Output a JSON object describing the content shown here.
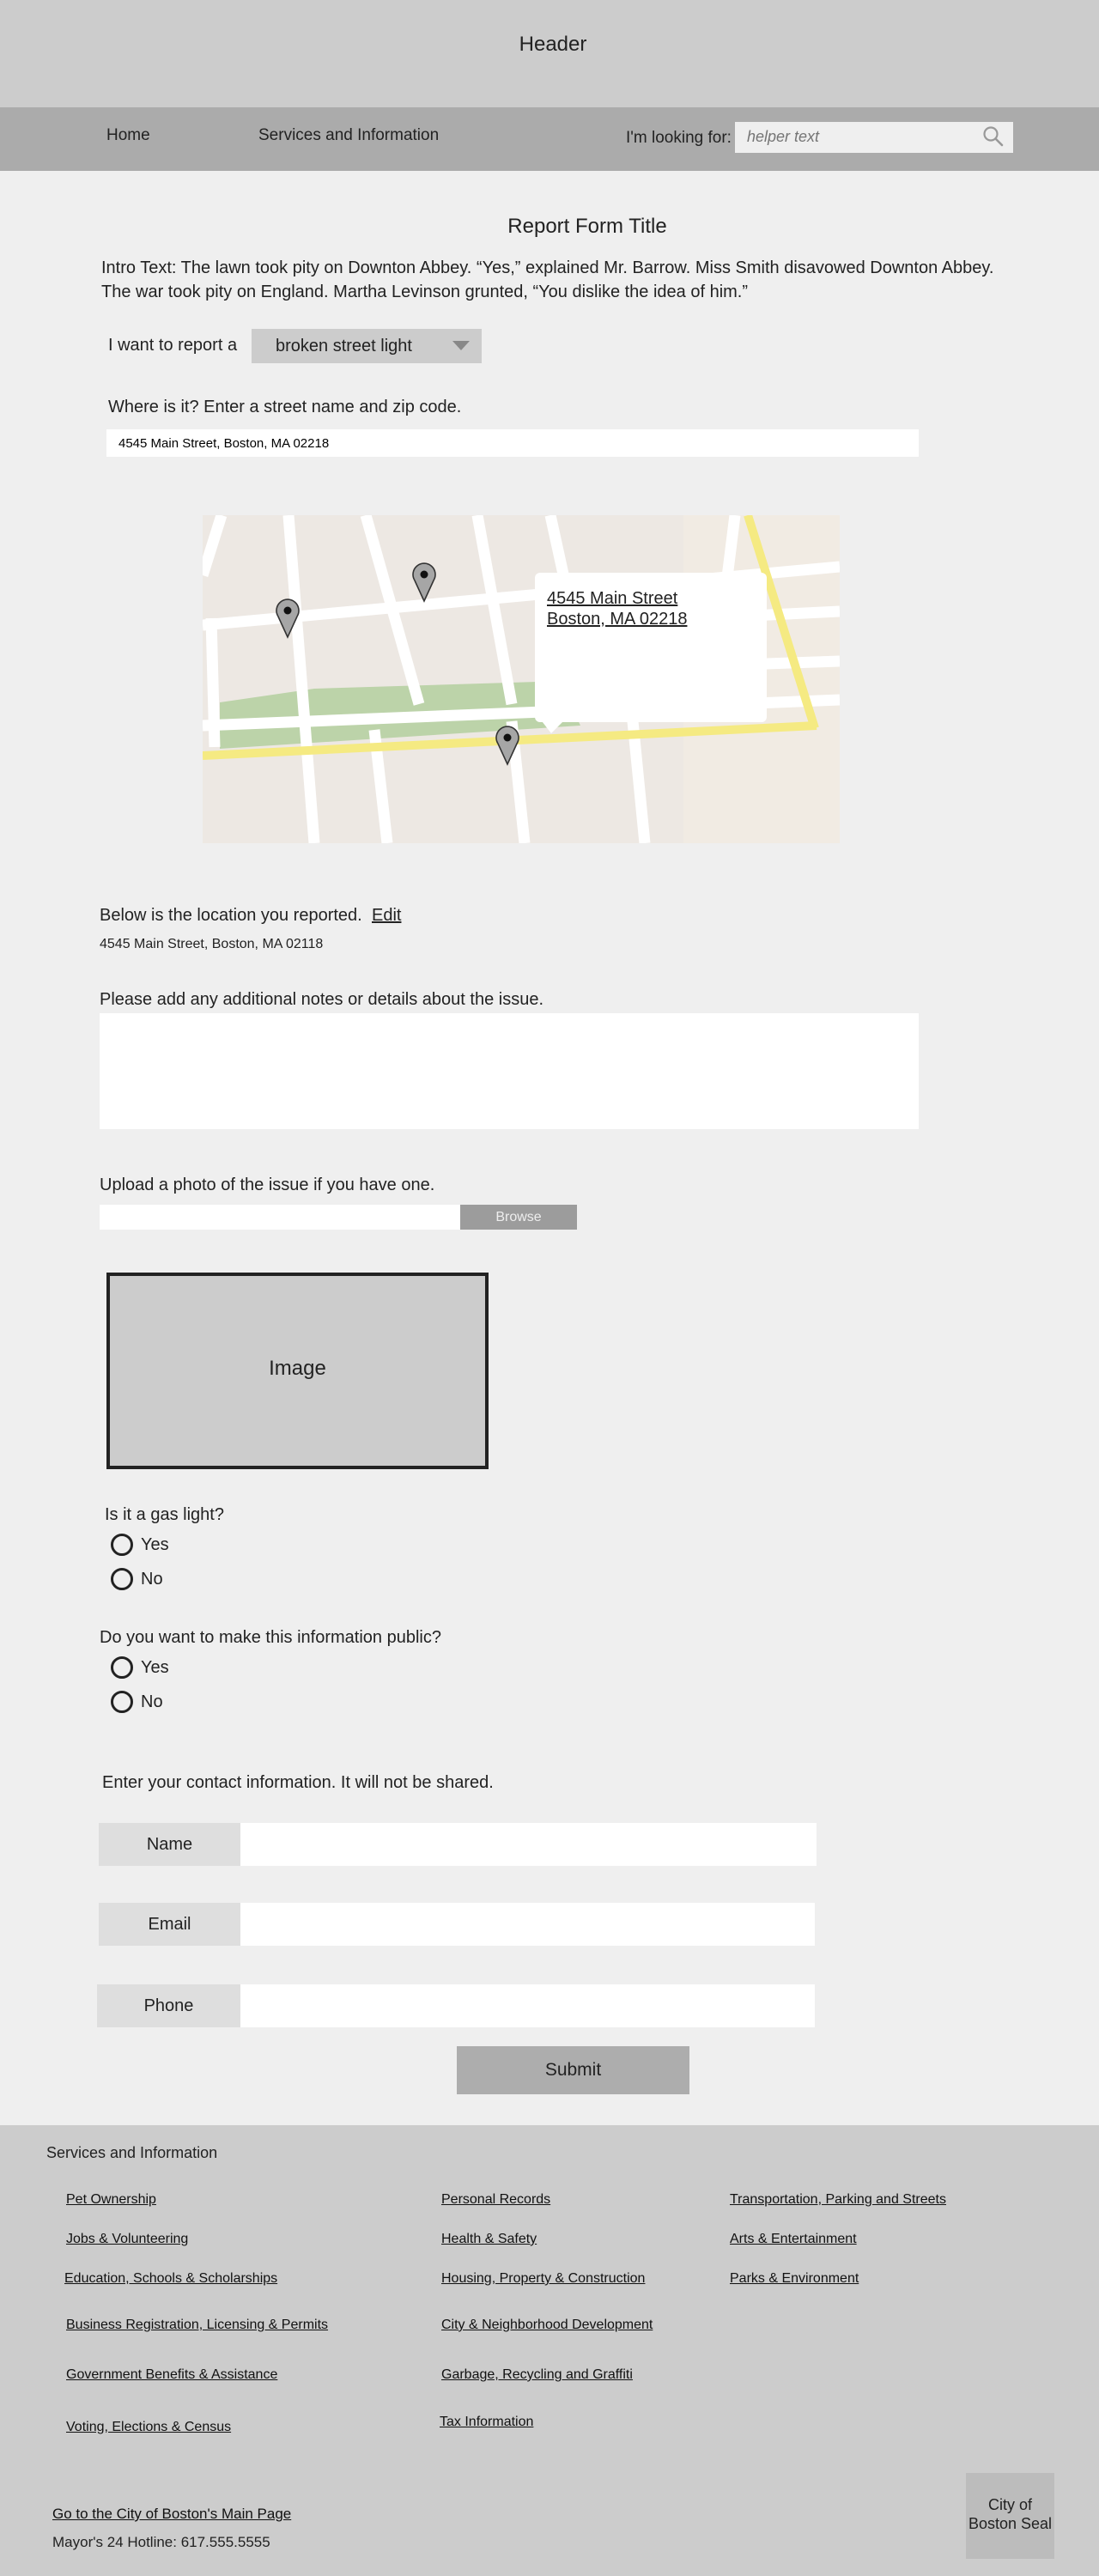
{
  "header": {
    "title": "Header"
  },
  "nav": {
    "home": "Home",
    "services": "Services and Information",
    "search_label": "I'm looking for:",
    "search_placeholder": "helper text"
  },
  "form": {
    "title": "Report Form Title",
    "intro_line1": "Intro Text: The lawn took pity on Downton Abbey. “Yes,” explained Mr. Barrow. Miss Smith disavowed Downton Abbey.",
    "intro_line2": "The war took pity on England. Martha Levinson grunted, “You dislike the idea of him.”",
    "report_label": "I want to report a",
    "report_selected": "broken street light",
    "where_label": "Where is it? Enter a street name and zip code.",
    "address_value": "4545 Main Street, Boston, MA 02218",
    "map_address_line1": "4545 Main Street",
    "map_address_line2": "Boston, MA 02218",
    "reported_label": "Below is the location you reported.",
    "edit_label": "Edit",
    "reported_address": "4545 Main Street, Boston, MA 02118",
    "notes_label": "Please add any additional notes or details about the issue.",
    "upload_label": "Upload a photo of the issue if you have one.",
    "browse_label": "Browse",
    "image_label": "Image",
    "gas_question": "Is it a gas light?",
    "public_question": "Do you want to make this information public?",
    "yes": "Yes",
    "no": "No",
    "contact_label": "Enter your contact information. It will not be shared.",
    "name_label": "Name",
    "email_label": "Email",
    "phone_label": "Phone",
    "submit_label": "Submit"
  },
  "footer": {
    "title": "Services and Information",
    "col1": [
      "Pet Ownership",
      "Jobs & Volunteering",
      "Education, Schools & Scholarships",
      "Business Registration, Licensing & Permits",
      "Government Benefits & Assistance",
      "Voting, Elections & Census"
    ],
    "col2": [
      "Personal Records",
      "Health & Safety",
      "Housing, Property & Construction",
      "City & Neighborhood Development",
      "Garbage, Recycling and Graffiti",
      "Tax Information"
    ],
    "col3": [
      "Transportation, Parking and Streets",
      "Arts & Entertainment",
      "Parks & Environment"
    ],
    "main_page_link": "Go to the City of Boston's Main Page",
    "hotline": "Mayor's 24 Hotline: 617.555.5555",
    "seal_line1": "City of",
    "seal_line2": "Boston Seal"
  }
}
